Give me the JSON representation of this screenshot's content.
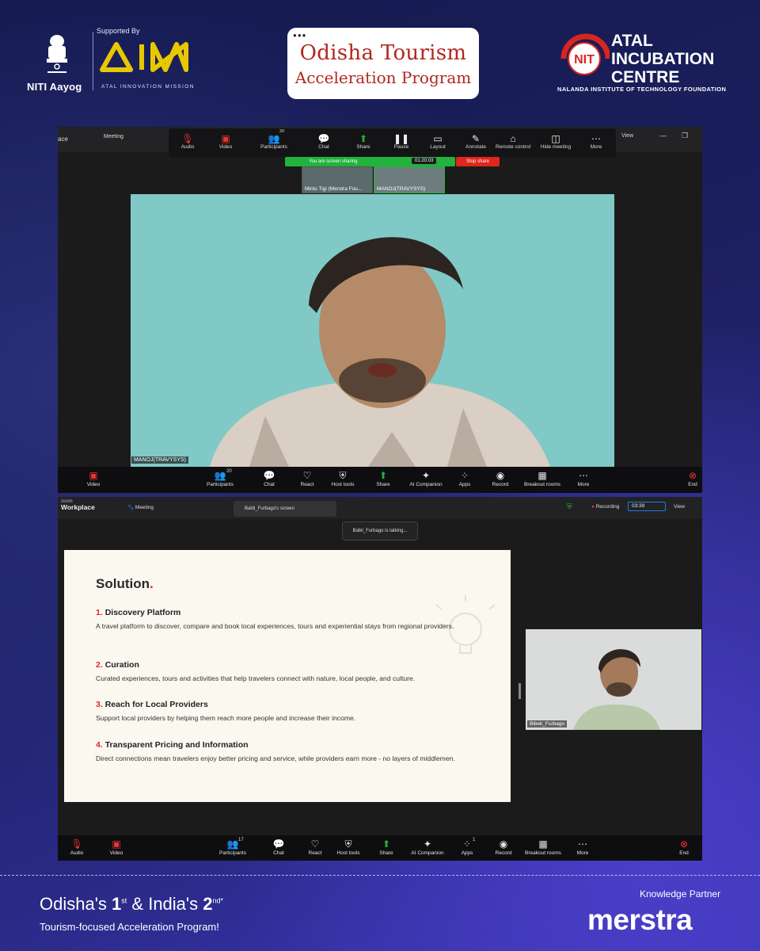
{
  "header": {
    "niti_label": "NITI Aayog",
    "emblem_caption": "सत्यमेव जयते",
    "supported_by": "Supported By",
    "aim_label": "ATAL INNOVATION MISSION",
    "program_title_line1": "Odisha Tourism",
    "program_title_line2": "Acceleration Program",
    "aic_title_1": "ATAL",
    "aic_title_2": "INCUBATION",
    "aic_title_3": "CENTRE",
    "aic_subtitle": "NALANDA INSTITUTE OF TECHNOLOGY FOUNDATION"
  },
  "window1": {
    "tabs": {
      "left": "ace",
      "meeting": "Meeting",
      "view": "View"
    },
    "toolbar": [
      {
        "label": "Audio",
        "icon": "mic-muted-icon"
      },
      {
        "label": "Video",
        "icon": "video-off-icon"
      },
      {
        "label": "Participants",
        "count": "20",
        "icon": "participants-icon"
      },
      {
        "label": "Chat",
        "icon": "chat-icon"
      },
      {
        "label": "Share",
        "icon": "share-icon"
      },
      {
        "label": "Pause",
        "icon": "pause-icon"
      },
      {
        "label": "Layout",
        "icon": "layout-icon"
      },
      {
        "label": "Annotate",
        "icon": "annotate-icon"
      },
      {
        "label": "Remote control",
        "icon": "remote-control-icon"
      },
      {
        "label": "Hide meeting",
        "icon": "hide-icon"
      },
      {
        "label": "More",
        "icon": "more-icon"
      }
    ],
    "sharing_text": "You are screen sharing",
    "timer": "01:20:03",
    "stop_share": "Stop share",
    "thumbnails": [
      "Mintu Tigi (Merstra Fou...",
      "MANOJ(TRAVYSYS)"
    ],
    "main_video_name": "MANOJ(TRAVYSYS)",
    "bottom_bar": [
      {
        "label": "Video"
      },
      {
        "label": "Participants",
        "count": "20"
      },
      {
        "label": "Chat"
      },
      {
        "label": "React"
      },
      {
        "label": "Host tools"
      },
      {
        "label": "Share"
      },
      {
        "label": "AI Companion"
      },
      {
        "label": "Apps"
      },
      {
        "label": "Record"
      },
      {
        "label": "Breakout rooms"
      },
      {
        "label": "More"
      },
      {
        "label": "End"
      }
    ]
  },
  "window2": {
    "app_small": "zoom",
    "app_big": "Workplace",
    "meeting_tab": "Meeting",
    "screen_tab": "Babli_Furbago's screen",
    "recording": "Recording",
    "rec_timer": "03:39",
    "view": "View",
    "talking": "Babli_Furbago is talking...",
    "slide": {
      "title": "Solution",
      "items": [
        {
          "num": "1.",
          "heading": "Discovery Platform",
          "text": "A travel platform to discover, compare and book local experiences, tours and experiential stays from regional providers."
        },
        {
          "num": "2.",
          "heading": "Curation",
          "text": "Curated experiences, tours and activities that help travelers connect with nature, local people, and culture."
        },
        {
          "num": "3.",
          "heading": "Reach for Local Providers",
          "text": "Support local providers by helping them reach more people and increase their income."
        },
        {
          "num": "4.",
          "heading": "Transparent Pricing and Information",
          "text": "Direct connections mean travelers enjoy better pricing and service, while providers earn more - no layers of middlemen."
        }
      ]
    },
    "participant_name": "Bibek_Furbago",
    "bottom_bar": [
      {
        "label": "Audio"
      },
      {
        "label": "Video"
      },
      {
        "label": "Participants",
        "count": "17"
      },
      {
        "label": "Chat"
      },
      {
        "label": "React"
      },
      {
        "label": "Host tools"
      },
      {
        "label": "Share"
      },
      {
        "label": "AI Companion"
      },
      {
        "label": "Apps",
        "count": "1"
      },
      {
        "label": "Record"
      },
      {
        "label": "Breakout rooms"
      },
      {
        "label": "More"
      },
      {
        "label": "End"
      }
    ]
  },
  "footer": {
    "odisha": "Odisha's",
    "first": "1",
    "first_sup": "st",
    "amp": "& India's",
    "second": "2",
    "second_sup": "nd*",
    "tagline": "Tourism-focused Acceleration Program!",
    "knowledge_partner": "Knowledge Partner",
    "partner_name": "merstra"
  },
  "colors": {
    "accent_red": "#e3262a",
    "zoom_green": "#21b33c",
    "brand_bg": "#1c1f5e"
  }
}
